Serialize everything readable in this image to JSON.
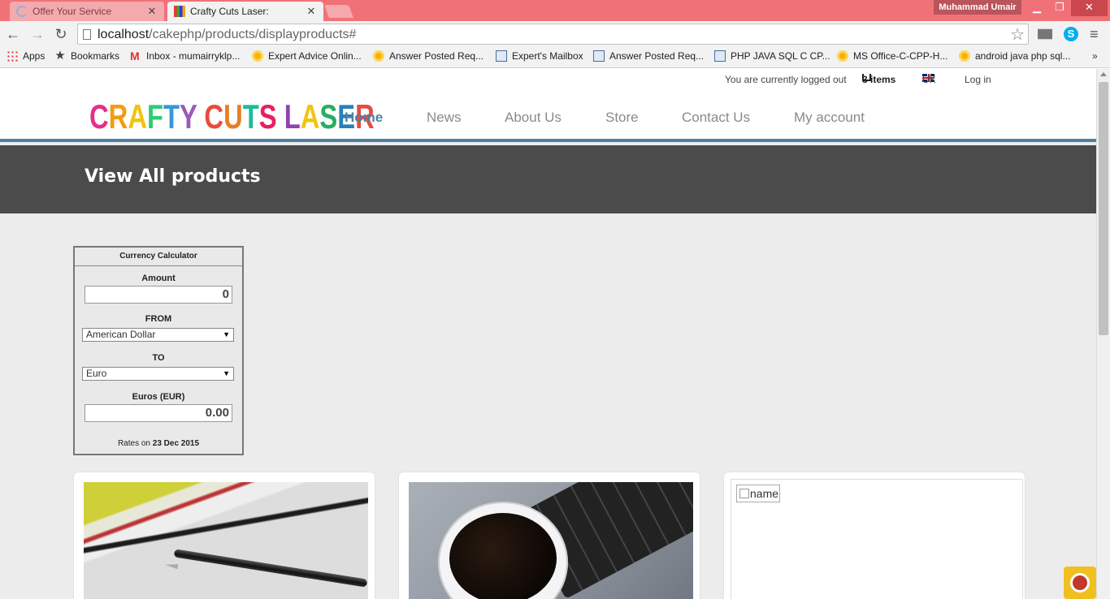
{
  "browser": {
    "tabs": [
      {
        "title": "Offer Your Service",
        "active": false
      },
      {
        "title": "Crafty Cuts Laser:",
        "active": true
      }
    ],
    "user": "Muhammad Umair",
    "url_host": "localhost",
    "url_path": "/cakephp/products/displayproducts#",
    "window_controls": {
      "minimize": "▁",
      "maximize": "❐",
      "close": "✕"
    },
    "nav": {
      "back": "←",
      "forward": "→",
      "reload": "↻",
      "star": "☆",
      "menu": "≡",
      "skype": "S"
    },
    "bookmarks": [
      {
        "label": "Apps",
        "icon": "apps-icon"
      },
      {
        "label": "Bookmarks",
        "icon": "star-icon"
      },
      {
        "label": "Inbox - mumairryklp...",
        "icon": "gmail-icon"
      },
      {
        "label": "Expert Advice Onlin...",
        "icon": "sun-icon"
      },
      {
        "label": "Answer Posted Req...",
        "icon": "sun-icon"
      },
      {
        "label": "Expert's Mailbox",
        "icon": "page-icon"
      },
      {
        "label": "Answer Posted Req...",
        "icon": "page-icon"
      },
      {
        "label": "PHP JAVA SQL C CP...",
        "icon": "page-icon"
      },
      {
        "label": "MS Office-C-CPP-H...",
        "icon": "sun-icon"
      },
      {
        "label": "android java php sql...",
        "icon": "sun-icon"
      }
    ],
    "bookmarks_more": "»"
  },
  "site": {
    "topbar": {
      "status": "You are currently logged out",
      "cart": "3 items",
      "locale": "UK",
      "login": "Log in"
    },
    "logo_text": "CRAFTY CUTS LASER",
    "logo_colors": [
      "#e62e8a",
      "#f39c12",
      "#f1c40f",
      "#2ecc71",
      "#3498db",
      "#9b59b6",
      "#e74c3c",
      "#e67e22",
      "#1abc9c",
      "#e91e63",
      "#8e44ad",
      "#f1c40f",
      "#27ae60",
      "#2980b9",
      "#e74c3c",
      "#f39c12",
      "#16a085"
    ],
    "nav": [
      {
        "label": "Home",
        "active": true
      },
      {
        "label": "News",
        "active": false
      },
      {
        "label": "About Us",
        "active": false
      },
      {
        "label": "Store",
        "active": false
      },
      {
        "label": "Contact Us",
        "active": false
      },
      {
        "label": "My account",
        "active": false
      }
    ],
    "accent_color": "#4d7fa5",
    "page_title": "View All products"
  },
  "calculator": {
    "title": "Currency Calculator",
    "amount_label": "Amount",
    "amount_value": "0",
    "from_label": "FROM",
    "from_value": "American Dollar",
    "to_label": "TO",
    "to_value": "Euro",
    "result_label": "Euros (EUR)",
    "result_value": "0.00",
    "rates_prefix": "Rates on",
    "rates_date": "23 Dec 2015",
    "caret": "▼"
  },
  "products": [
    {
      "image": "notebook-pen-photo"
    },
    {
      "image": "coffee-cup-photo"
    },
    {
      "image": "broken-image",
      "alt": "name"
    }
  ]
}
